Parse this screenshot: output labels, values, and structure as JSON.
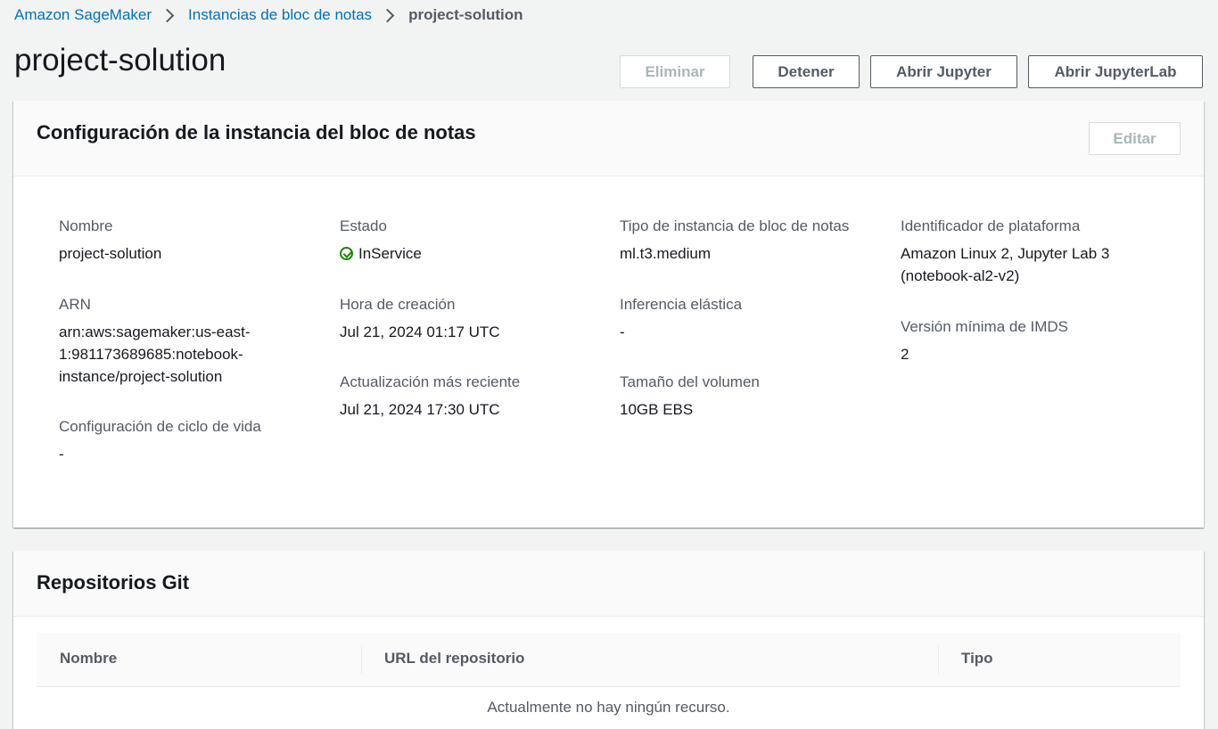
{
  "breadcrumb": {
    "items": [
      "Amazon SageMaker",
      "Instancias de bloc de notas",
      "project-solution"
    ]
  },
  "page": {
    "title": "project-solution"
  },
  "actions": {
    "delete_label": "Eliminar",
    "stop_label": "Detener",
    "open_jupyter_label": "Abrir Jupyter",
    "open_jupyterlab_label": "Abrir JupyterLab"
  },
  "config": {
    "title": "Configuración de la instancia del bloc de notas",
    "edit_label": "Editar",
    "fields": {
      "name": {
        "label": "Nombre",
        "value": "project-solution"
      },
      "arn": {
        "label": "ARN",
        "value_lines": [
          "arn:aws:sagemaker:us-east-",
          "1:981173689685:notebook-",
          "instance/project-solution"
        ]
      },
      "lifecycle": {
        "label": "Configuración de ciclo de vida",
        "value": "-"
      },
      "status": {
        "label": "Estado",
        "value": "InService",
        "color": "#1d8102",
        "icon": "check-circle-icon"
      },
      "created": {
        "label": "Hora de creación",
        "value": "Jul 21, 2024 01:17 UTC"
      },
      "updated": {
        "label": "Actualización más reciente",
        "value": "Jul 21, 2024 17:30 UTC"
      },
      "instance_type": {
        "label": "Tipo de instancia de bloc de notas",
        "value": "ml.t3.medium"
      },
      "elastic_inference": {
        "label": "Inferencia elástica",
        "value": "-"
      },
      "volume_size": {
        "label": "Tamaño del volumen",
        "value": "10GB EBS"
      },
      "platform": {
        "label": "Identificador de plataforma",
        "value_lines": [
          "Amazon Linux 2, Jupyter Lab 3",
          "(notebook-al2-v2)"
        ]
      },
      "imds": {
        "label": "Versión mínima de IMDS",
        "value": "2"
      }
    }
  },
  "git": {
    "title": "Repositorios Git",
    "columns": [
      "Nombre",
      "URL del repositorio",
      "Tipo"
    ],
    "empty_text": "Actualmente no hay ningún recurso."
  },
  "colors": {
    "link": "#0073bb",
    "success": "#1d8102",
    "background": "#f2f3f3"
  }
}
